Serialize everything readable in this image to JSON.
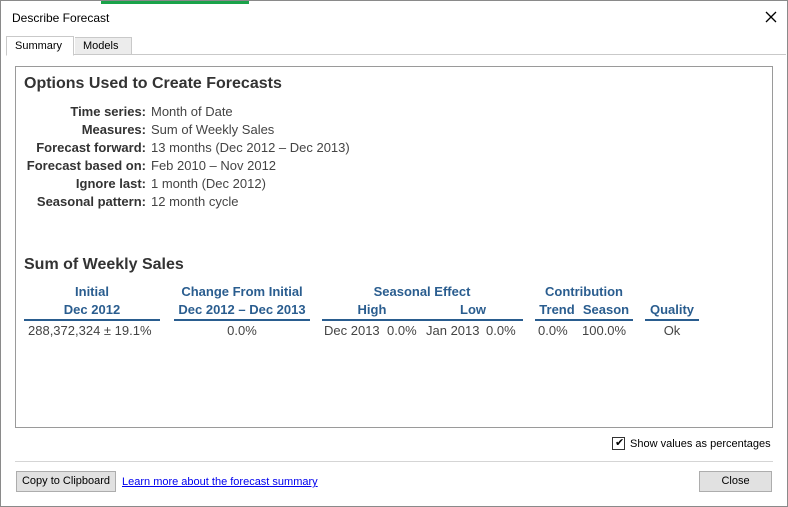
{
  "window": {
    "title": "Describe Forecast"
  },
  "tabs": [
    {
      "label": "Summary",
      "active": true
    },
    {
      "label": "Models",
      "active": false
    }
  ],
  "options": {
    "heading": "Options Used to Create Forecasts",
    "rows": [
      {
        "label": "Time series:",
        "value": "Month of Date"
      },
      {
        "label": "Measures:",
        "value": "Sum of Weekly Sales"
      },
      {
        "label": "Forecast forward:",
        "value": "13 months (Dec 2012 – Dec 2013)"
      },
      {
        "label": "Forecast based on:",
        "value": "Feb 2010 – Nov 2012"
      },
      {
        "label": "Ignore last:",
        "value": "1 month (Dec 2012)"
      },
      {
        "label": "Seasonal pattern:",
        "value": "12 month cycle"
      }
    ]
  },
  "summary": {
    "heading": "Sum of Weekly Sales",
    "headers": {
      "initial_top": "Initial",
      "initial_bottom": "Dec 2012",
      "change_top": "Change From Initial",
      "change_bottom": "Dec 2012 – Dec 2013",
      "seasonal_top": "Seasonal Effect",
      "high": "High",
      "low": "Low",
      "contribution_top": "Contribution",
      "trend": "Trend",
      "season": "Season",
      "quality": "Quality"
    },
    "values": {
      "initial": "288,372,324 ±  19.1%",
      "change": "0.0%",
      "high_date": "Dec 2013",
      "high_value": "0.0%",
      "low_date": "Jan 2013",
      "low_value": "0.0%",
      "trend": "0.0%",
      "season": "100.0%",
      "quality": "Ok"
    }
  },
  "show_percentages": {
    "label": "Show values as percentages",
    "checked": true
  },
  "footer": {
    "copy_button": "Copy to Clipboard",
    "learn_link": "Learn more about the forecast summary",
    "close_button": "Close"
  },
  "colors": {
    "accent": "#2a5d8f",
    "strip": "#1aa34a"
  }
}
